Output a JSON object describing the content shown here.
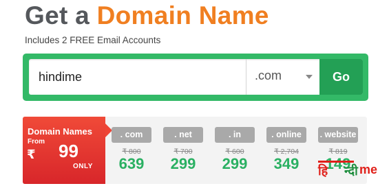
{
  "headline": {
    "lead": "Get a",
    "accent": "Domain Name"
  },
  "subheadline": "Includes 2 FREE Email Accounts",
  "search": {
    "input_value": "hindime",
    "tld_selected": ".com",
    "go_label": "Go"
  },
  "promo": {
    "title": "Domain Names",
    "from_label": "From",
    "currency": "₹",
    "price": "99",
    "only_label": "ONLY"
  },
  "tlds": [
    {
      "name": ". com",
      "old_price": "₹ 800",
      "new_price": "639"
    },
    {
      "name": ". net",
      "old_price": "₹ 700",
      "new_price": "299"
    },
    {
      "name": ". in",
      "old_price": "₹ 600",
      "new_price": "299"
    },
    {
      "name": ". online",
      "old_price": "₹ 2,704",
      "new_price": "349"
    },
    {
      "name": ". website",
      "old_price": "₹ 819",
      "new_price": "149"
    }
  ],
  "colors": {
    "accent_orange": "#f07f21",
    "search_green": "#33b967",
    "go_green": "#23a055",
    "promo_red": "#e2312d",
    "price_green": "#2ab062"
  },
  "watermark": "हिन्दीme"
}
